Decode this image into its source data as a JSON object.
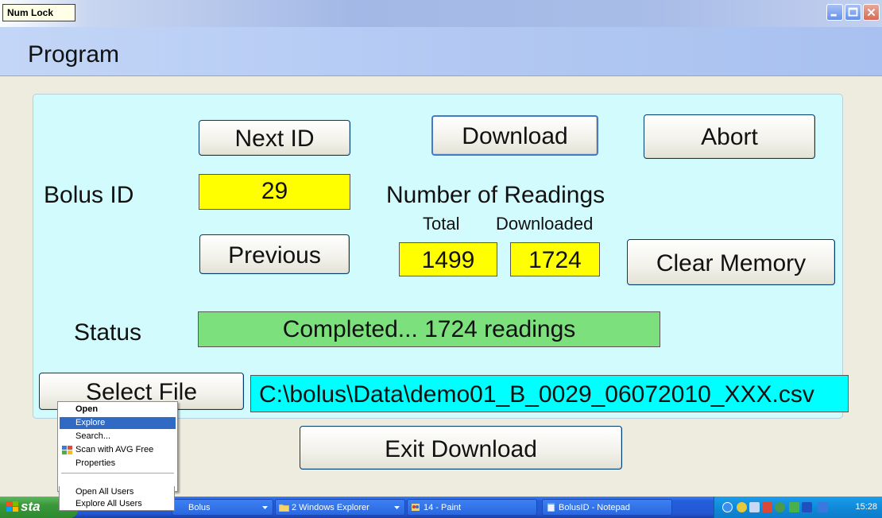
{
  "titlebar": {
    "indicator": "Num Lock",
    "controls": {
      "minimize": "minimize-icon",
      "maximize": "maximize-icon",
      "close": "close-icon"
    }
  },
  "menubar": {
    "program": "Program"
  },
  "buttons": {
    "next_id": "Next ID",
    "download": "Download",
    "abort": "Abort",
    "previous": "Previous",
    "clear_memory": "Clear Memory",
    "select_file": "Select File",
    "exit_download": "Exit Download"
  },
  "bolus": {
    "label": "Bolus ID",
    "value": "29"
  },
  "readings": {
    "title": "Number of Readings",
    "total_label": "Total",
    "downloaded_label": "Downloaded",
    "total_value": "1499",
    "downloaded_value": "1724"
  },
  "status": {
    "label": "Status",
    "value": "Completed... 1724 readings"
  },
  "file": {
    "path": "C:\\bolus\\Data\\demo01_B_0029_06072010_XXX.csv"
  },
  "context_menu": {
    "items": [
      "Open",
      "Explore",
      "Search...",
      "Scan with AVG Free",
      "Properties",
      "Open All Users",
      "Explore All Users"
    ],
    "highlighted": "Explore",
    "default": "Open"
  },
  "taskbar": {
    "start_label": "sta",
    "tasks": [
      {
        "label": "Bolus",
        "icon": "app-icon"
      },
      {
        "label": "2 Windows Explorer",
        "icon": "folder-icon"
      },
      {
        "label": "14 - Paint",
        "icon": "paint-icon"
      },
      {
        "label": "BolusID - Notepad",
        "icon": "notepad-icon"
      }
    ],
    "clock": "15:28"
  },
  "colors": {
    "panel": "#d2fbfd",
    "yellow_field": "#ffff00",
    "status_field": "#7ce07c",
    "path_field": "#00ffff",
    "taskbar": "#245edb",
    "start": "#3a973a",
    "tray": "#0f8bd9"
  }
}
